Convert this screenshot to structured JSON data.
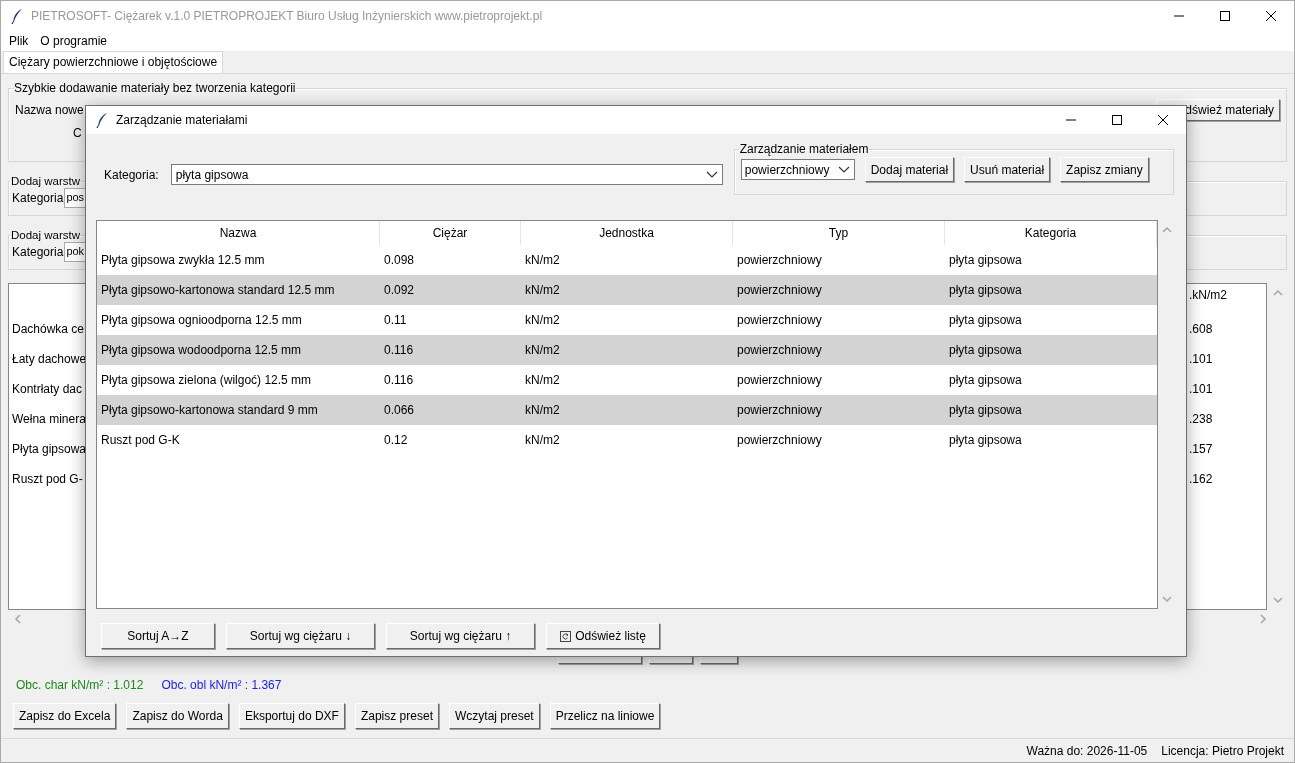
{
  "window": {
    "title": "PIETROSOFT- Ciężarek v.1.0 PIETROPROJEKT Biuro Usług Inżynierskich www.pietroprojekt.pl",
    "active": false
  },
  "menu": [
    "Plik",
    "O programie"
  ],
  "tabs": [
    {
      "label": "Ciężary powierzchniowe i objętościowe",
      "selected": true
    }
  ],
  "quick_add": {
    "title": "Szybkie dodawanie materiały bez tworzenia kategorii",
    "label": "Nazwa nowe",
    "label_2": "C",
    "button": "dświeź materiały"
  },
  "layer_groups": [
    {
      "title": "Dodaj warstw",
      "label": "Kategoria",
      "value": "pos"
    },
    {
      "title": "Dodaj warstw",
      "label": "Kategoria",
      "value": "pok"
    }
  ],
  "layers": {
    "column_header": ".kN/m2",
    "rows": [
      {
        "name": "Dachówka ce",
        "value": ".608"
      },
      {
        "name": "Łaty dachowe",
        "value": ".101"
      },
      {
        "name": "Kontrłaty dac",
        "value": ".101"
      },
      {
        "name": "Wełna minera",
        "value": ".238"
      },
      {
        "name": "Płyta gipsowa",
        "value": ".157"
      },
      {
        "name": "Ruszt pod G-",
        "value": ".162"
      }
    ]
  },
  "totals": [
    {
      "text": "Obc. char kN/m² : 1.012",
      "color": "#1a8a1a"
    },
    {
      "text": "Obc. obl kN/m² : 1.367",
      "color": "#1a1aff"
    }
  ],
  "buttons": [
    "Zapisz do Excela",
    "Zapisz do Worda",
    "Eksportuj do DXF",
    "Zapisz preset",
    "Wczytaj preset",
    "Przelicz na liniowe"
  ],
  "status_bar": [
    "Ważna do: 2026-11-05",
    "Licencja: Pietro Projekt"
  ],
  "dialog": {
    "title": "Zarządzanie materiałami",
    "category_label": "Kategoria:",
    "category": "płyta gipsowa",
    "group_title": "Zarządzanie materiałem",
    "type": "powierzchniowy",
    "actions": [
      "Dodaj materiał",
      "Usuń materiał",
      "Zapisz zmiany"
    ],
    "columns": [
      "Nazwa",
      "Ciężar",
      "Jednostka",
      "Typ",
      "Kategoria"
    ],
    "rows": [
      [
        "Płyta gipsowa zwykła 12.5 mm",
        "0.098",
        "kN/m2",
        "powierzchniowy",
        "płyta gipsowa"
      ],
      [
        "Płyta gipsowo-kartonowa standard 12.5 mm",
        "0.092",
        "kN/m2",
        "powierzchniowy",
        "płyta gipsowa"
      ],
      [
        "Płyta gipsowa ognioodporna 12.5 mm",
        "0.11",
        "kN/m2",
        "powierzchniowy",
        "płyta gipsowa"
      ],
      [
        "Płyta gipsowa wodoodporna 12.5 mm",
        "0.116",
        "kN/m2",
        "powierzchniowy",
        "płyta gipsowa"
      ],
      [
        "Płyta gipsowa zielona (wilgoć) 12.5 mm",
        "0.116",
        "kN/m2",
        "powierzchniowy",
        "płyta gipsowa"
      ],
      [
        "Płyta gipsowo-kartonowa standard 9 mm",
        "0.066",
        "kN/m2",
        "powierzchniowy",
        "płyta gipsowa"
      ],
      [
        "Ruszt pod G-K",
        "0.12",
        "kN/m2",
        "powierzchniowy",
        "płyta gipsowa"
      ]
    ],
    "sort_buttons": [
      {
        "label": "Sortuj A→Z",
        "kind": "plain"
      },
      {
        "label": "Sortuj wg ciężaru ↓",
        "kind": "plain"
      },
      {
        "label": "Sortuj wg ciężaru ↑",
        "kind": "plain"
      },
      {
        "label": "Odśwież listę",
        "kind": "refresh"
      }
    ]
  }
}
